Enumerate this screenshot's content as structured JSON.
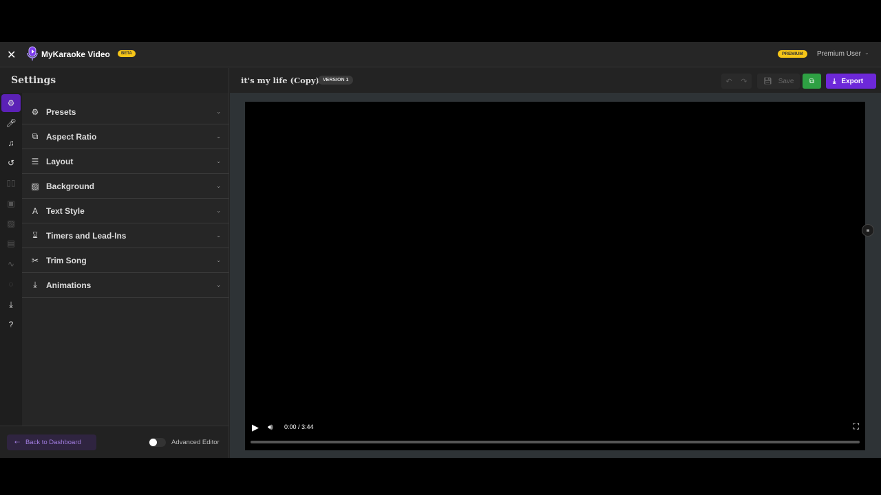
{
  "header": {
    "app_name": "MyKaraoke Video",
    "beta_badge": "BETA",
    "premium_badge": "PREMIUM",
    "user_name": "Premium User"
  },
  "settings": {
    "title": "Settings",
    "items": [
      {
        "label": "Presets",
        "icon": "gear-badge-icon"
      },
      {
        "label": "Aspect Ratio",
        "icon": "aspect-ratio-icon"
      },
      {
        "label": "Layout",
        "icon": "layout-icon"
      },
      {
        "label": "Background",
        "icon": "background-icon"
      },
      {
        "label": "Text Style",
        "icon": "text-style-icon"
      },
      {
        "label": "Timers and Lead-Ins",
        "icon": "hourglass-icon"
      },
      {
        "label": "Trim Song",
        "icon": "scissors-icon"
      },
      {
        "label": "Animations",
        "icon": "animation-icon"
      }
    ]
  },
  "footer": {
    "back_label": "Back to Dashboard",
    "advanced_editor_label": "Advanced Editor",
    "advanced_editor_on": false
  },
  "editor": {
    "title": "it's my life (Copy)",
    "version": "VERSION 1",
    "save_label": "Save",
    "export_label": "Export"
  },
  "player": {
    "time": "0:00 / 3:44",
    "progress": 0
  },
  "colors": {
    "accent": "#6d28d9",
    "premium": "#f5c518",
    "copy": "#2ea043"
  }
}
